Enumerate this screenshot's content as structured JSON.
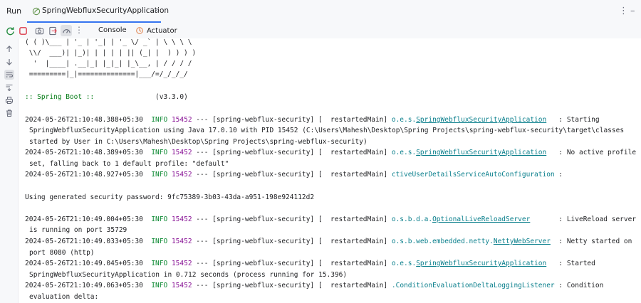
{
  "tabbar": {
    "run_title": "Run",
    "tab_label": "SpringWebfluxSecurityApplication",
    "close_glyph": "×",
    "more_glyph": "⋮",
    "minimize_glyph": "–"
  },
  "toolbar": {
    "console_tab": "Console",
    "actuator_tab": "Actuator",
    "more_glyph": "⋮"
  },
  "console": {
    "banner": [
      "( ( )\\___ | '_ | '_| | '_ \\/ _` | \\ \\ \\ \\",
      " \\\\/  ___)| |_)| | | | | || (_| |  ) ) ) )",
      "  '  |____| .__|_| |_|_| |_\\__, | / / / /",
      " =========|_|==============|___/=/_/_/_/"
    ],
    "spring_boot_label": ":: Spring Boot ::",
    "spring_boot_version": "(v3.3.0)",
    "security_password": "Using generated security password: 9fc75389-3b03-43da-a951-198e924112d2",
    "log": [
      {
        "timestamp": "2024-05-26T21:10:48.388+05:30",
        "level": "INFO",
        "pid": "15452",
        "thread": "--- [spring-webflux-security] [  restartedMain]",
        "logger_prefix": "o.e.s.",
        "logger_name": "SpringWebfluxSecurityApplication",
        "message": "   : Starting",
        "continuation": [
          "SpringWebfluxSecurityApplication using Java 17.0.10 with PID 15452 (C:\\Users\\Mahesh\\Desktop\\Spring Projects\\spring-webflux-security\\target\\classes",
          "started by User in C:\\Users\\Mahesh\\Desktop\\Spring Projects\\spring-webflux-security)"
        ]
      },
      {
        "timestamp": "2024-05-26T21:10:48.389+05:30",
        "level": "INFO",
        "pid": "15452",
        "thread": "--- [spring-webflux-security] [  restartedMain]",
        "logger_prefix": "o.e.s.",
        "logger_name": "SpringWebfluxSecurityApplication",
        "message": "   : No active profile",
        "continuation": [
          "set, falling back to 1 default profile: \"default\""
        ]
      },
      {
        "timestamp": "2024-05-26T21:10:48.927+05:30",
        "level": "INFO",
        "pid": "15452",
        "thread": "--- [spring-webflux-security] [  restartedMain]",
        "logger_prefix": "",
        "logger_name": "ctiveUserDetailsServiceAutoConfiguration",
        "message": " :",
        "continuation": []
      },
      {
        "timestamp": "2024-05-26T21:10:49.004+05:30",
        "level": "INFO",
        "pid": "15452",
        "thread": "--- [spring-webflux-security] [  restartedMain]",
        "logger_prefix": "o.s.b.d.a.",
        "logger_name": "OptionalLiveReloadServer",
        "message": "       : LiveReload server",
        "continuation": [
          "is running on port 35729"
        ]
      },
      {
        "timestamp": "2024-05-26T21:10:49.033+05:30",
        "level": "INFO",
        "pid": "15452",
        "thread": "--- [spring-webflux-security] [  restartedMain]",
        "logger_prefix": "o.s.b.web.embedded.netty.",
        "logger_name": "NettyWebServer",
        "message": "  : Netty started on",
        "continuation": [
          "port 8080 (http)"
        ]
      },
      {
        "timestamp": "2024-05-26T21:10:49.045+05:30",
        "level": "INFO",
        "pid": "15452",
        "thread": "--- [spring-webflux-security] [  restartedMain]",
        "logger_prefix": "o.e.s.",
        "logger_name": "SpringWebfluxSecurityApplication",
        "message": "   : Started",
        "continuation": [
          "SpringWebfluxSecurityApplication in 0.712 seconds (process running for 15.396)"
        ]
      },
      {
        "timestamp": "2024-05-26T21:10:49.063+05:30",
        "level": "INFO",
        "pid": "15452",
        "thread": "--- [spring-webflux-security] [  restartedMain]",
        "logger_prefix": ".",
        "logger_name": "ConditionEvaluationDeltaLoggingListener",
        "message": " : Condition",
        "continuation": [
          "evaluation delta:"
        ]
      }
    ]
  }
}
